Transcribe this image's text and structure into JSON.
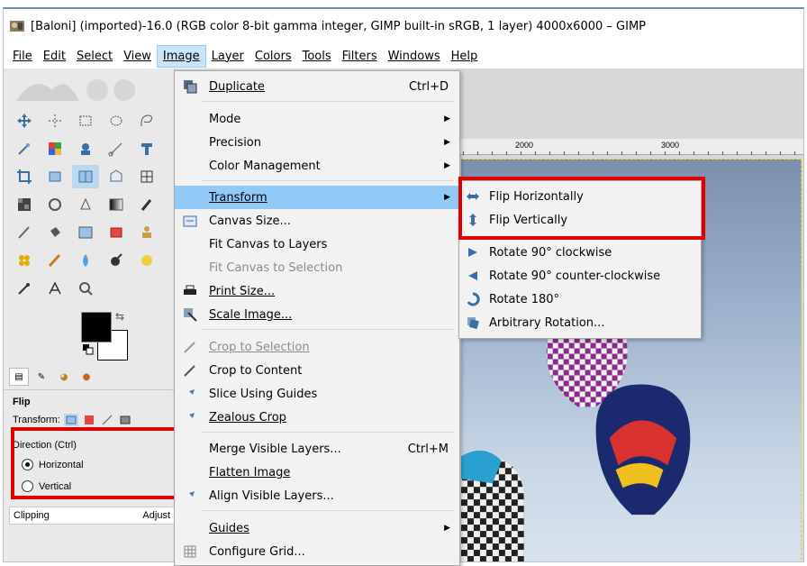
{
  "window": {
    "title": "[Baloni] (imported)-16.0 (RGB color 8-bit gamma integer, GIMP built-in sRGB, 1 layer) 4000x6000 – GIMP"
  },
  "menubar": [
    "File",
    "Edit",
    "Select",
    "View",
    "Image",
    "Layer",
    "Colors",
    "Tools",
    "Filters",
    "Windows",
    "Help"
  ],
  "image_menu": {
    "duplicate": "Duplicate",
    "duplicate_shortcut": "Ctrl+D",
    "mode": "Mode",
    "precision": "Precision",
    "color_management": "Color Management",
    "transform": "Transform",
    "canvas_size": "Canvas Size...",
    "fit_canvas_layers": "Fit Canvas to Layers",
    "fit_canvas_selection": "Fit Canvas to Selection",
    "print_size": "Print Size...",
    "scale_image": "Scale Image...",
    "crop_selection": "Crop to Selection",
    "crop_content": "Crop to Content",
    "slice_guides": "Slice Using Guides",
    "zealous_crop": "Zealous Crop",
    "merge_visible": "Merge Visible Layers...",
    "merge_shortcut": "Ctrl+M",
    "flatten": "Flatten Image",
    "align_visible": "Align Visible Layers...",
    "guides": "Guides",
    "configure_grid": "Configure Grid..."
  },
  "transform_submenu": {
    "flip_h": "Flip Horizontally",
    "flip_v": "Flip Vertically",
    "rot90cw": "Rotate 90° clockwise",
    "rot90ccw": "Rotate 90° counter-clockwise",
    "rot180": "Rotate 180°",
    "arbitrary": "Arbitrary Rotation..."
  },
  "tool_options": {
    "title": "Flip",
    "transform_label": "Transform:",
    "direction_label": "Direction  (Ctrl)",
    "horizontal": "Horizontal",
    "vertical": "Vertical",
    "selected_direction": "Horizontal",
    "clipping": "Clipping",
    "clipping_value": "Adjust"
  },
  "ruler": {
    "label_2000": "2000",
    "label_3000": "3000"
  },
  "colors": {
    "highlight": "#91c9f7",
    "annotation_red": "#e00000",
    "menubar_active": "#cce4f7"
  }
}
